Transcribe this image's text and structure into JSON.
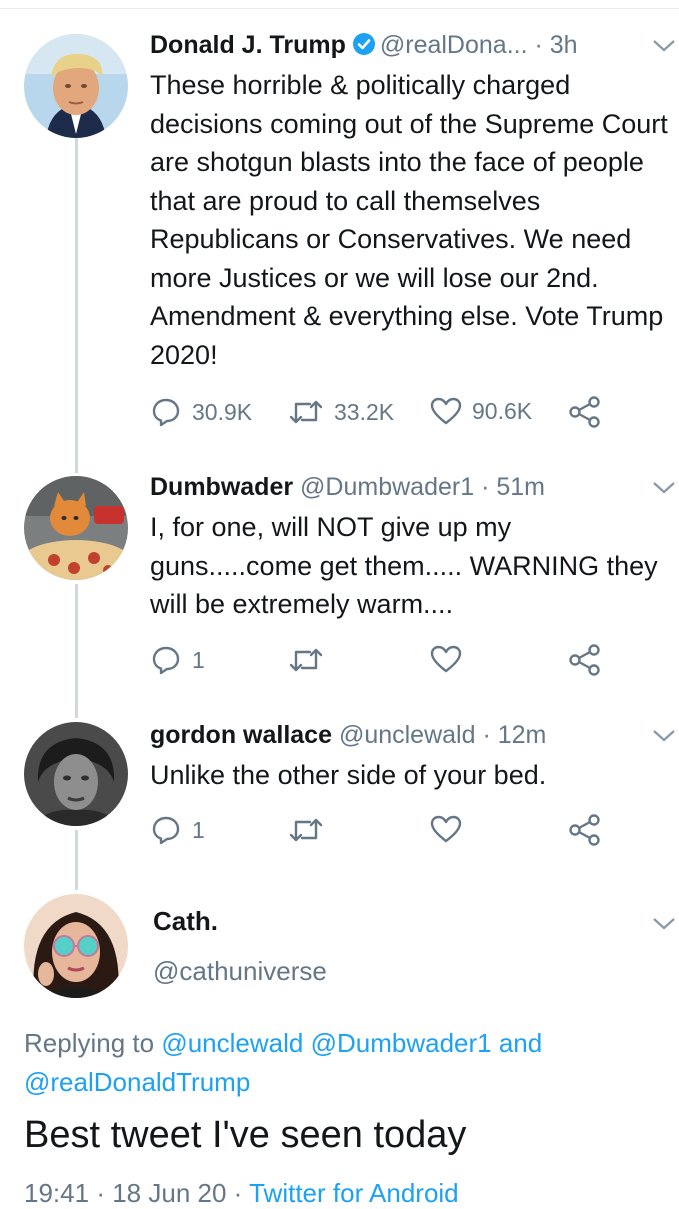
{
  "tweets": [
    {
      "name": "Donald J. Trump",
      "handle": "@realDona...",
      "separator": "·",
      "time": "3h",
      "verified": true,
      "text": "These horrible & politically charged decisions coming out of the Supreme Court are shotgun blasts into the face of people that are proud to call themselves Republicans or Conservatives. We need more Justices or we will lose our 2nd. Amendment & everything else. Vote Trump 2020!",
      "replies": "30.9K",
      "retweets": "33.2K",
      "likes": "90.6K"
    },
    {
      "name": "Dumbwader",
      "handle": "@Dumbwader1",
      "separator": "·",
      "time": "51m",
      "text": "I, for one, will NOT give up my guns.....come get them..... WARNING they will be extremely warm....",
      "replies": "1",
      "retweets": "",
      "likes": ""
    },
    {
      "name": "gordon wallace",
      "handle": "@unclewald",
      "separator": "·",
      "time": "12m",
      "text": "Unlike the other side of your bed.",
      "replies": "1",
      "retweets": "",
      "likes": ""
    }
  ],
  "focus": {
    "name": "Cath.",
    "handle": "@cathuniverse",
    "replying_prefix": "Replying to",
    "replying_to_1": "@unclewald",
    "replying_to_2": "@Dumbwader1",
    "replying_and": "and",
    "replying_to_3": "@realDonaldTrump",
    "text": "Best tweet I've seen today",
    "time": "19:41",
    "sep1": "·",
    "date": "18 Jun 20",
    "sep2": "·",
    "source": "Twitter for Android"
  },
  "icons": {
    "reply": "reply-icon",
    "retweet": "retweet-icon",
    "like": "heart-icon",
    "share": "share-icon",
    "verified": "verified-badge-icon",
    "menu": "chevron-down-icon"
  },
  "colors": {
    "link": "#1da1f2",
    "muted": "#657786",
    "text": "#14171a",
    "thread_line": "#cfd9de"
  }
}
